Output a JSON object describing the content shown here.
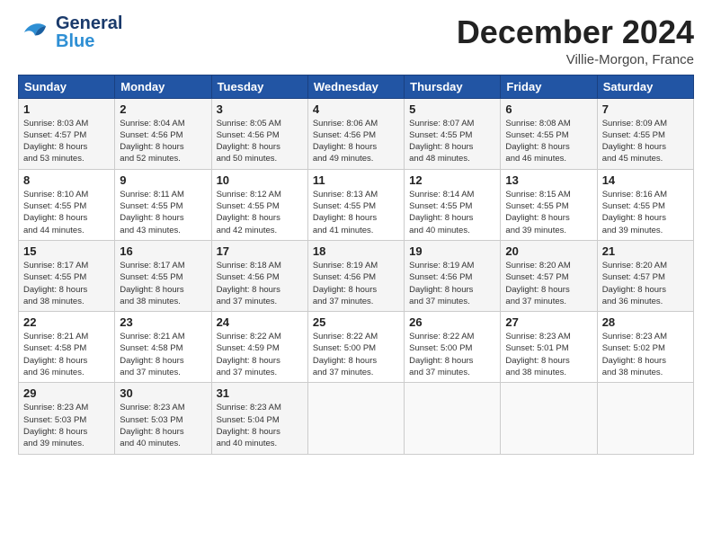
{
  "header": {
    "logo_general": "General",
    "logo_blue": "Blue",
    "month_year": "December 2024",
    "location": "Villie-Morgon, France"
  },
  "weekdays": [
    "Sunday",
    "Monday",
    "Tuesday",
    "Wednesday",
    "Thursday",
    "Friday",
    "Saturday"
  ],
  "weeks": [
    [
      {
        "day": "1",
        "sunrise": "8:03 AM",
        "sunset": "4:57 PM",
        "daylight": "8 hours and 53 minutes."
      },
      {
        "day": "2",
        "sunrise": "8:04 AM",
        "sunset": "4:56 PM",
        "daylight": "8 hours and 52 minutes."
      },
      {
        "day": "3",
        "sunrise": "8:05 AM",
        "sunset": "4:56 PM",
        "daylight": "8 hours and 50 minutes."
      },
      {
        "day": "4",
        "sunrise": "8:06 AM",
        "sunset": "4:56 PM",
        "daylight": "8 hours and 49 minutes."
      },
      {
        "day": "5",
        "sunrise": "8:07 AM",
        "sunset": "4:55 PM",
        "daylight": "8 hours and 48 minutes."
      },
      {
        "day": "6",
        "sunrise": "8:08 AM",
        "sunset": "4:55 PM",
        "daylight": "8 hours and 46 minutes."
      },
      {
        "day": "7",
        "sunrise": "8:09 AM",
        "sunset": "4:55 PM",
        "daylight": "8 hours and 45 minutes."
      }
    ],
    [
      {
        "day": "8",
        "sunrise": "8:10 AM",
        "sunset": "4:55 PM",
        "daylight": "8 hours and 44 minutes."
      },
      {
        "day": "9",
        "sunrise": "8:11 AM",
        "sunset": "4:55 PM",
        "daylight": "8 hours and 43 minutes."
      },
      {
        "day": "10",
        "sunrise": "8:12 AM",
        "sunset": "4:55 PM",
        "daylight": "8 hours and 42 minutes."
      },
      {
        "day": "11",
        "sunrise": "8:13 AM",
        "sunset": "4:55 PM",
        "daylight": "8 hours and 41 minutes."
      },
      {
        "day": "12",
        "sunrise": "8:14 AM",
        "sunset": "4:55 PM",
        "daylight": "8 hours and 40 minutes."
      },
      {
        "day": "13",
        "sunrise": "8:15 AM",
        "sunset": "4:55 PM",
        "daylight": "8 hours and 39 minutes."
      },
      {
        "day": "14",
        "sunrise": "8:16 AM",
        "sunset": "4:55 PM",
        "daylight": "8 hours and 39 minutes."
      }
    ],
    [
      {
        "day": "15",
        "sunrise": "8:17 AM",
        "sunset": "4:55 PM",
        "daylight": "8 hours and 38 minutes."
      },
      {
        "day": "16",
        "sunrise": "8:17 AM",
        "sunset": "4:55 PM",
        "daylight": "8 hours and 38 minutes."
      },
      {
        "day": "17",
        "sunrise": "8:18 AM",
        "sunset": "4:56 PM",
        "daylight": "8 hours and 37 minutes."
      },
      {
        "day": "18",
        "sunrise": "8:19 AM",
        "sunset": "4:56 PM",
        "daylight": "8 hours and 37 minutes."
      },
      {
        "day": "19",
        "sunrise": "8:19 AM",
        "sunset": "4:56 PM",
        "daylight": "8 hours and 37 minutes."
      },
      {
        "day": "20",
        "sunrise": "8:20 AM",
        "sunset": "4:57 PM",
        "daylight": "8 hours and 37 minutes."
      },
      {
        "day": "21",
        "sunrise": "8:20 AM",
        "sunset": "4:57 PM",
        "daylight": "8 hours and 36 minutes."
      }
    ],
    [
      {
        "day": "22",
        "sunrise": "8:21 AM",
        "sunset": "4:58 PM",
        "daylight": "8 hours and 36 minutes."
      },
      {
        "day": "23",
        "sunrise": "8:21 AM",
        "sunset": "4:58 PM",
        "daylight": "8 hours and 37 minutes."
      },
      {
        "day": "24",
        "sunrise": "8:22 AM",
        "sunset": "4:59 PM",
        "daylight": "8 hours and 37 minutes."
      },
      {
        "day": "25",
        "sunrise": "8:22 AM",
        "sunset": "5:00 PM",
        "daylight": "8 hours and 37 minutes."
      },
      {
        "day": "26",
        "sunrise": "8:22 AM",
        "sunset": "5:00 PM",
        "daylight": "8 hours and 37 minutes."
      },
      {
        "day": "27",
        "sunrise": "8:23 AM",
        "sunset": "5:01 PM",
        "daylight": "8 hours and 38 minutes."
      },
      {
        "day": "28",
        "sunrise": "8:23 AM",
        "sunset": "5:02 PM",
        "daylight": "8 hours and 38 minutes."
      }
    ],
    [
      {
        "day": "29",
        "sunrise": "8:23 AM",
        "sunset": "5:03 PM",
        "daylight": "8 hours and 39 minutes."
      },
      {
        "day": "30",
        "sunrise": "8:23 AM",
        "sunset": "5:03 PM",
        "daylight": "8 hours and 40 minutes."
      },
      {
        "day": "31",
        "sunrise": "8:23 AM",
        "sunset": "5:04 PM",
        "daylight": "8 hours and 40 minutes."
      },
      null,
      null,
      null,
      null
    ]
  ]
}
